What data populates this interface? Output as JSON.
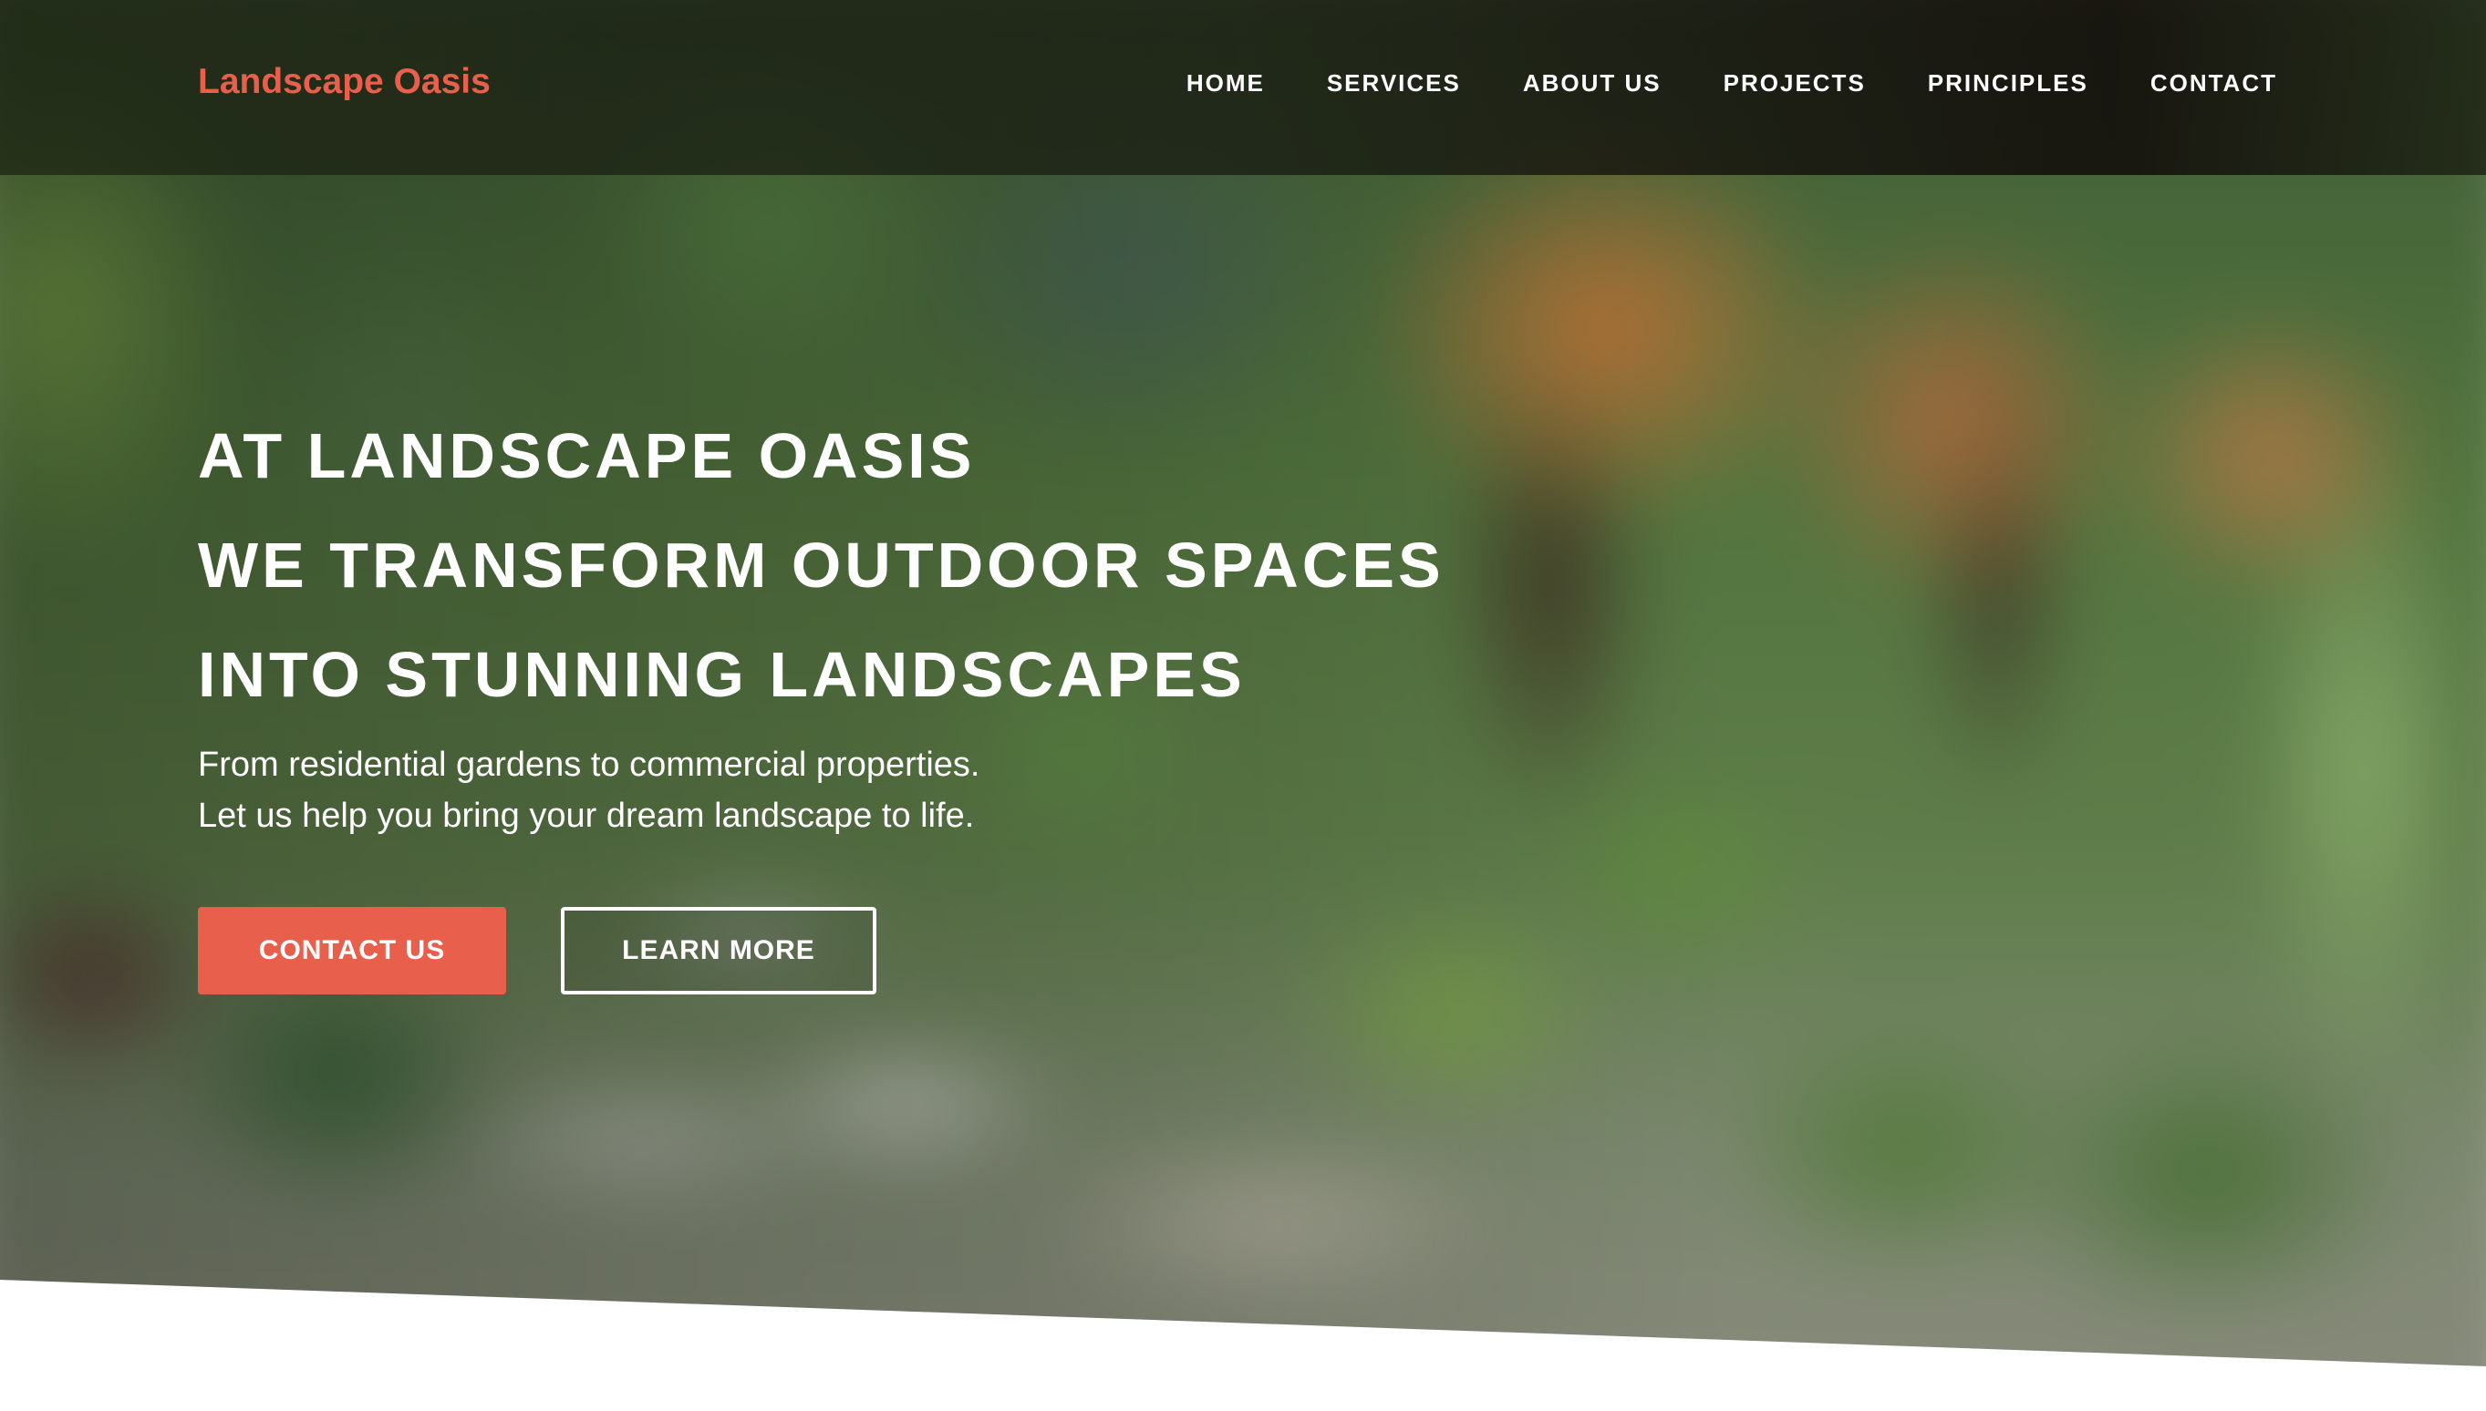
{
  "brand": {
    "name": "Landscape Oasis",
    "accent_color": "#e8604c"
  },
  "nav": {
    "items": [
      {
        "label": "HOME"
      },
      {
        "label": "SERVICES"
      },
      {
        "label": "ABOUT US"
      },
      {
        "label": "PROJECTS"
      },
      {
        "label": "PRINCIPLES"
      },
      {
        "label": "CONTACT"
      }
    ]
  },
  "hero": {
    "headline": [
      "AT LANDSCAPE OASIS",
      "WE TRANSFORM OUTDOOR SPACES",
      "INTO STUNNING LANDSCAPES"
    ],
    "subtext": [
      "From residential gardens to commercial properties.",
      "Let us help you bring your dream landscape to life."
    ],
    "primary_button": "CONTACT US",
    "secondary_button": "LEARN MORE"
  }
}
